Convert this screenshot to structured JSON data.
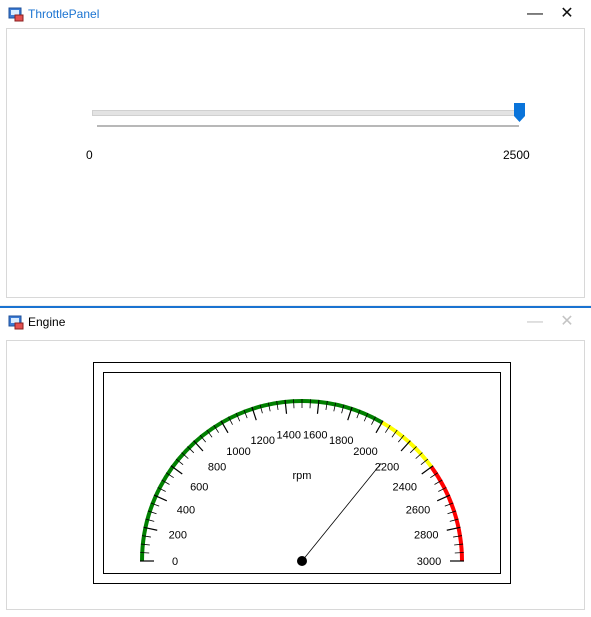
{
  "throttle_window": {
    "title": "ThrottlePanel",
    "minimize": "—",
    "close": "✕",
    "slider": {
      "min_label": "0",
      "max_label": "2500",
      "value": 2500,
      "min": 0,
      "max": 2500,
      "accent": "#0a74da"
    }
  },
  "engine_window": {
    "title": "Engine",
    "minimize": "—",
    "close": "✕",
    "gauge": {
      "unit_label": "rpm",
      "min": 0,
      "max": 3000,
      "value": 2150,
      "ticks": [
        "0",
        "200",
        "400",
        "600",
        "800",
        "1000",
        "1200",
        "1400",
        "1600",
        "1800",
        "2000",
        "2200",
        "2400",
        "2600",
        "2800",
        "3000"
      ],
      "zones": [
        {
          "from": 0,
          "to": 2000,
          "color": "#008000"
        },
        {
          "from": 2000,
          "to": 2400,
          "color": "#ffff00"
        },
        {
          "from": 2400,
          "to": 3000,
          "color": "#ff0000"
        }
      ]
    }
  }
}
